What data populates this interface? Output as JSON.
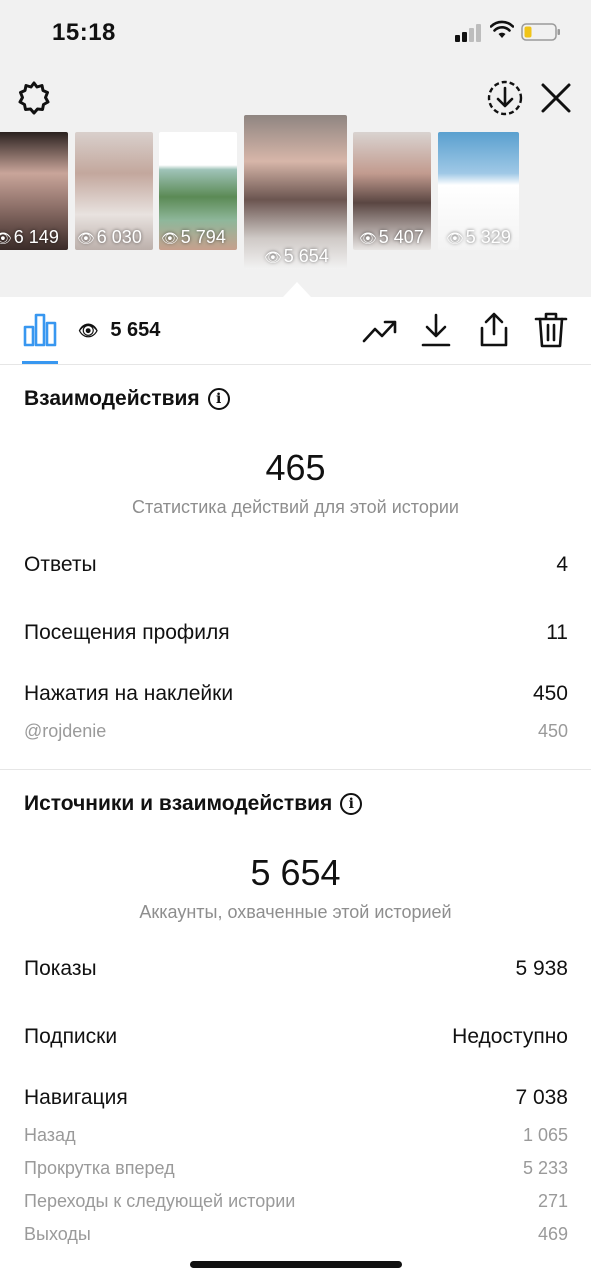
{
  "status_bar": {
    "time": "15:18"
  },
  "thumbnails": [
    {
      "views": "6 149",
      "bg": "#6d5a55"
    },
    {
      "views": "6 030",
      "bg": "#b7a8a3"
    },
    {
      "views": "5 794",
      "bg": "#5f8a4f"
    },
    {
      "views": "5 654",
      "bg": "#8c7c77"
    },
    {
      "views": "5 407",
      "bg": "#7a6864"
    },
    {
      "views": "5 329",
      "bg": "#9fb4c8"
    }
  ],
  "action_bar": {
    "views": "5 654"
  },
  "interactions": {
    "title": "Взаимодействия",
    "total": "465",
    "subtitle": "Статистика действий для этой истории",
    "rows": [
      {
        "label": "Ответы",
        "value": "4"
      },
      {
        "label": "Посещения профиля",
        "value": "11"
      },
      {
        "label": "Нажатия на наклейки",
        "value": "450"
      }
    ],
    "sticker": {
      "label": "@rojdenie",
      "value": "450"
    }
  },
  "discovery": {
    "title": "Источники и взаимодействия",
    "total": "5 654",
    "subtitle": "Аккаунты, охваченные этой историей",
    "rows": [
      {
        "label": "Показы",
        "value": "5 938"
      },
      {
        "label": "Подписки",
        "value": "Недоступно"
      },
      {
        "label": "Навигация",
        "value": "7 038"
      }
    ],
    "navigation": [
      {
        "label": "Назад",
        "value": "1 065"
      },
      {
        "label": "Прокрутка вперед",
        "value": "5 233"
      },
      {
        "label": "Переходы к следующей истории",
        "value": "271"
      },
      {
        "label": "Выходы",
        "value": "469"
      }
    ]
  },
  "colors": {
    "accent": "#3897f0",
    "secondary_text": "#8e8e8e",
    "top_bg": "#f1f1f1"
  }
}
